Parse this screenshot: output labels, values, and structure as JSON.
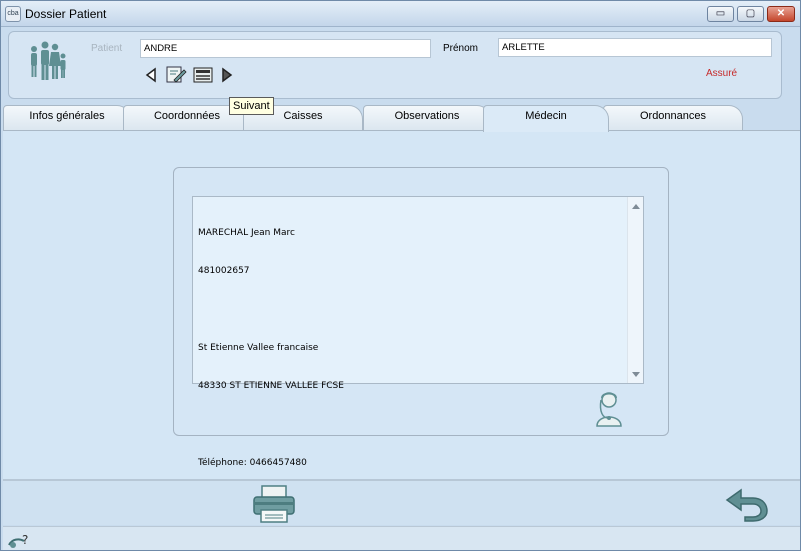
{
  "window": {
    "app_icon": "cba",
    "title": "Dossier Patient",
    "minimize_label": "▭",
    "maximize_label": "▢",
    "close_label": "✕"
  },
  "header": {
    "patient_label": "Patient",
    "patient_value": "ANDRE",
    "prenom_label": "Prénom",
    "prenom_value": "ARLETTE",
    "status": "Assuré",
    "status_color": "#c62a2a",
    "nav_icons": [
      "previous-arrow-icon",
      "edit-patient-icon",
      "id-card-icon",
      "next-arrow-icon"
    ],
    "tooltip": "Suivant"
  },
  "tabs": [
    {
      "label": "Infos générales"
    },
    {
      "label": "Coordonnées"
    },
    {
      "label": "Caisses"
    },
    {
      "label": "Observations"
    },
    {
      "label": "Médecin",
      "active": true
    },
    {
      "label": "Ordonnances"
    }
  ],
  "medecin": {
    "lines": [
      "MARECHAL Jean Marc",
      "481002657",
      "",
      "St Etienne Vallee francaise",
      "48330 ST ETIENNE VALLEE FCSE",
      "",
      "Téléphone: 0466457480"
    ]
  },
  "footer": {
    "icons": [
      "printer-icon",
      "back-arrow-icon",
      "status-help-icon"
    ]
  }
}
